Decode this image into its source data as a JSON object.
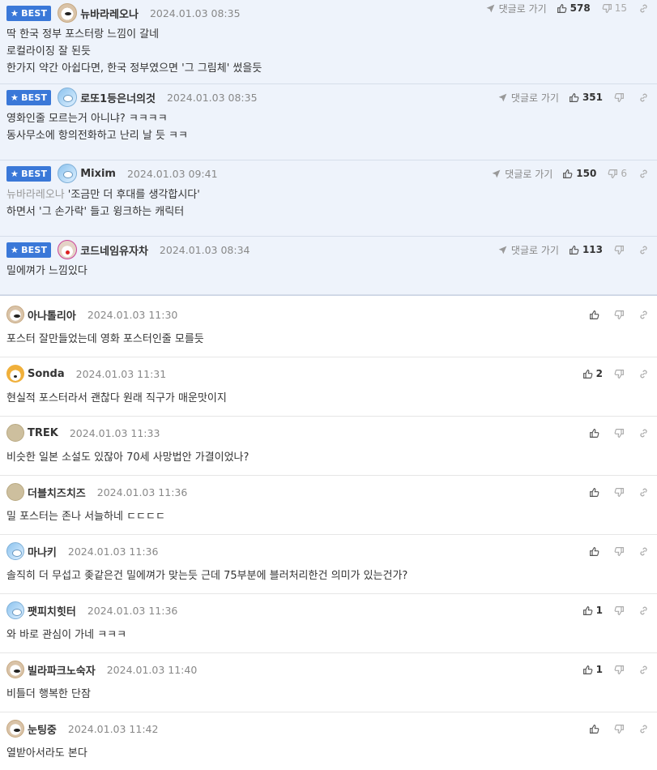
{
  "best_badge_label": "BEST",
  "reply_label": "댓글로 가기",
  "best_comments": [
    {
      "nick": "뉴바라레오나",
      "date": "2024.01.03 08:35",
      "likes": "578",
      "dislikes": "15",
      "lines": [
        "딱 한국 정부 포스터랑 느낌이 갈네",
        "로컬라이징 잘 된듯",
        "한가지 약간 아쉽다면, 한국 정부였으면 '그 그림체' 썼을듯"
      ],
      "avatar": "dog"
    },
    {
      "nick": "로또1등은너의것",
      "date": "2024.01.03 08:35",
      "likes": "351",
      "dislikes": "",
      "lines": [
        "영화인줄 모르는거 아니냐? ㅋㅋㅋㅋ",
        "동사무소에 항의전화하고 난리 날 듯 ㅋㅋ"
      ],
      "avatar": "blue"
    },
    {
      "nick": "Mixim",
      "date": "2024.01.03 09:41",
      "likes": "150",
      "dislikes": "6",
      "mention": "뉴바라레오나",
      "lines": [
        "'조금만 더 후대를 생각합시다'",
        "하면서 '그 손가락' 들고 윙크하는 캐릭터"
      ],
      "avatar": "blue"
    },
    {
      "nick": "코드네임유자차",
      "date": "2024.01.03 08:34",
      "likes": "113",
      "dislikes": "",
      "lines": [
        "밀에껴가 느낌있다"
      ],
      "avatar": "clown"
    }
  ],
  "comments": [
    {
      "nick": "아나톨리아",
      "date": "2024.01.03 11:30",
      "likes": "",
      "text": "포스터 잘만들었는데 영화 포스터인줄 모를듯",
      "avatar": "dog"
    },
    {
      "nick": "Sonda",
      "date": "2024.01.03 11:31",
      "likes": "2",
      "text": "현실적 포스터라서 괜찮다 원래 직구가 매운맛이지",
      "avatar": "fox"
    },
    {
      "nick": "TREK",
      "date": "2024.01.03 11:33",
      "likes": "",
      "text": "비슷한 일본 소설도 있잖아 70세 사망법안 가결이었나?",
      "avatar": "plain"
    },
    {
      "nick": "더블치즈치즈",
      "date": "2024.01.03 11:36",
      "likes": "",
      "text": "밀 포스터는 존나 서늘하네 ㄷㄷㄷㄷ",
      "avatar": "plain"
    },
    {
      "nick": "마나키",
      "date": "2024.01.03 11:36",
      "likes": "",
      "text": "솔직히 더 무섭고 좆같은건 밀에껴가 맞는듯 근데 75부분에 블러처리한건 의미가 있는건가?",
      "avatar": "blue"
    },
    {
      "nick": "팻피치힛터",
      "date": "2024.01.03 11:36",
      "likes": "1",
      "text": "와 바로 관심이 가네 ㅋㅋㅋ",
      "avatar": "blue"
    },
    {
      "nick": "빌라파크노숙자",
      "date": "2024.01.03 11:40",
      "likes": "1",
      "text": "비틀더 행복한 단잠",
      "avatar": "dog"
    },
    {
      "nick": "눈팅중",
      "date": "2024.01.03 11:42",
      "likes": "",
      "text": "열받아서라도 본다",
      "avatar": "dog"
    }
  ]
}
